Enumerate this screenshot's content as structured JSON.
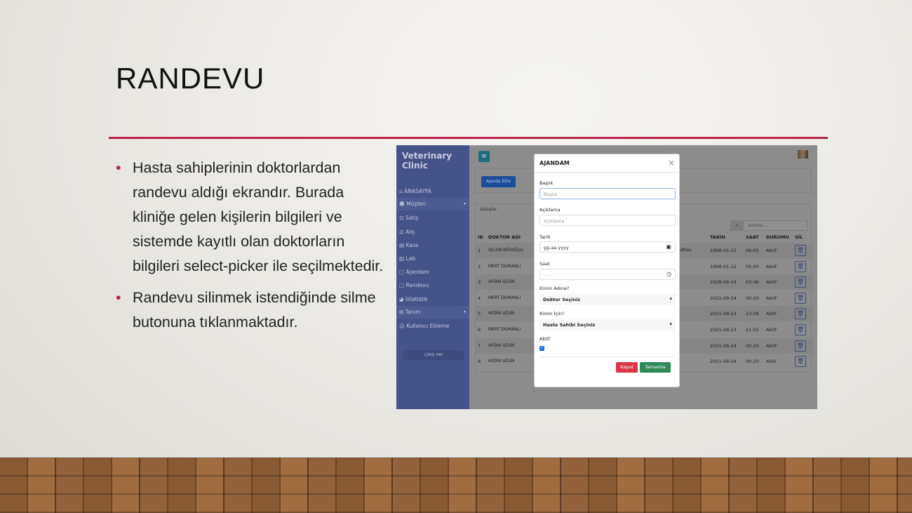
{
  "slide": {
    "title": "RANDEVU",
    "bullets": [
      "Hasta sahiplerinin doktorlardan randevu aldığı ekrandır. Burada kliniğe gelen kişilerin bilgileri ve sistemde kayıtlı olan doktorların bilgileri select-picker ile seçilmektedir.",
      "Randevu silinmek istendiğinde silme butonuna tıklanmaktadır."
    ],
    "accent": "#b5264a"
  },
  "app": {
    "brand": "Veterinary Clinic",
    "sidebar": [
      {
        "label": "ANASAYFA",
        "icon": "home-icon"
      },
      {
        "label": "Müşteri",
        "icon": "users-icon"
      },
      {
        "label": "Satış",
        "icon": "scale-icon"
      },
      {
        "label": "Alış",
        "icon": "scale-icon"
      },
      {
        "label": "Kasa",
        "icon": "cash-icon"
      },
      {
        "label": "Lab",
        "icon": "lab-icon"
      },
      {
        "label": "Ajandam",
        "icon": "calendar-icon"
      },
      {
        "label": "Randevu",
        "icon": "calendar-icon"
      },
      {
        "label": "İstatistik",
        "icon": "chart-pie-icon"
      },
      {
        "label": "Tanım",
        "icon": "plus-square-icon"
      },
      {
        "label": "Kullanıcı Ekleme",
        "icon": "user-plus-icon"
      }
    ],
    "logout": "ÇIKIŞ YAP",
    "add_button": "Ajanda Ekle",
    "section": "Satışlar",
    "search_placeholder": "arama...",
    "columns": {
      "id": "ID",
      "doctor": "DOKTOR ADI",
      "date": "TARİH",
      "time": "SAAT",
      "status": "DURUMU",
      "delete": "SİL"
    },
    "rows": [
      {
        "id": "1",
        "doctor": "SELEN KÖSOĞLU",
        "partial": "a Haftası",
        "date": "1998-01-23",
        "time": "09:05",
        "status": "Aktif"
      },
      {
        "id": "2",
        "doctor": "MERT DUMANLI",
        "date": "1998-01-12",
        "time": "05:00",
        "status": "Aktif"
      },
      {
        "id": "3",
        "doctor": "AYDIN UZUN",
        "date": "2028-06-14",
        "time": "03:46",
        "status": "Aktif"
      },
      {
        "id": "4",
        "doctor": "MERT DUMANLI",
        "date": "2021-09-24",
        "time": "00:20",
        "status": "Aktif"
      },
      {
        "id": "5",
        "doctor": "AYDIN UZUN",
        "date": "2021-09-23",
        "time": "23:39",
        "status": "Aktif"
      },
      {
        "id": "6",
        "doctor": "MERT DUMANLI",
        "date": "2021-09-23",
        "time": "21:55",
        "status": "Aktif"
      },
      {
        "id": "7",
        "doctor": "AYDIN UZUN",
        "date": "2021-09-24",
        "time": "00:20",
        "status": "Aktif"
      },
      {
        "id": "8",
        "doctor": "AYDIN UZUN",
        "date": "2021-09-24",
        "time": "00:20",
        "status": "Aktif"
      }
    ],
    "modal": {
      "title": "AJANDAM",
      "baslik_label": "Başlık",
      "baslik_placeholder": "Başlık",
      "aciklama_label": "Açıklama",
      "aciklama_placeholder": "Açıklama",
      "tarih_label": "Tarih",
      "tarih_value": "gg.aa.yyyy",
      "saat_label": "Saat",
      "saat_value": "--:--",
      "kimin_adina_label": "Kimin Adına?",
      "kimin_adina_value": "Doktor Seçiniz",
      "kimin_icin_label": "Kimin İçin?",
      "kimin_icin_value": "Hasta Sahibi Seçiniz",
      "aktif_label": "Aktif",
      "aktif_checked": true,
      "close": "Kapat",
      "submit": "Tamamla",
      "close_color": "#dc3545",
      "submit_color": "#2e8b57"
    }
  }
}
